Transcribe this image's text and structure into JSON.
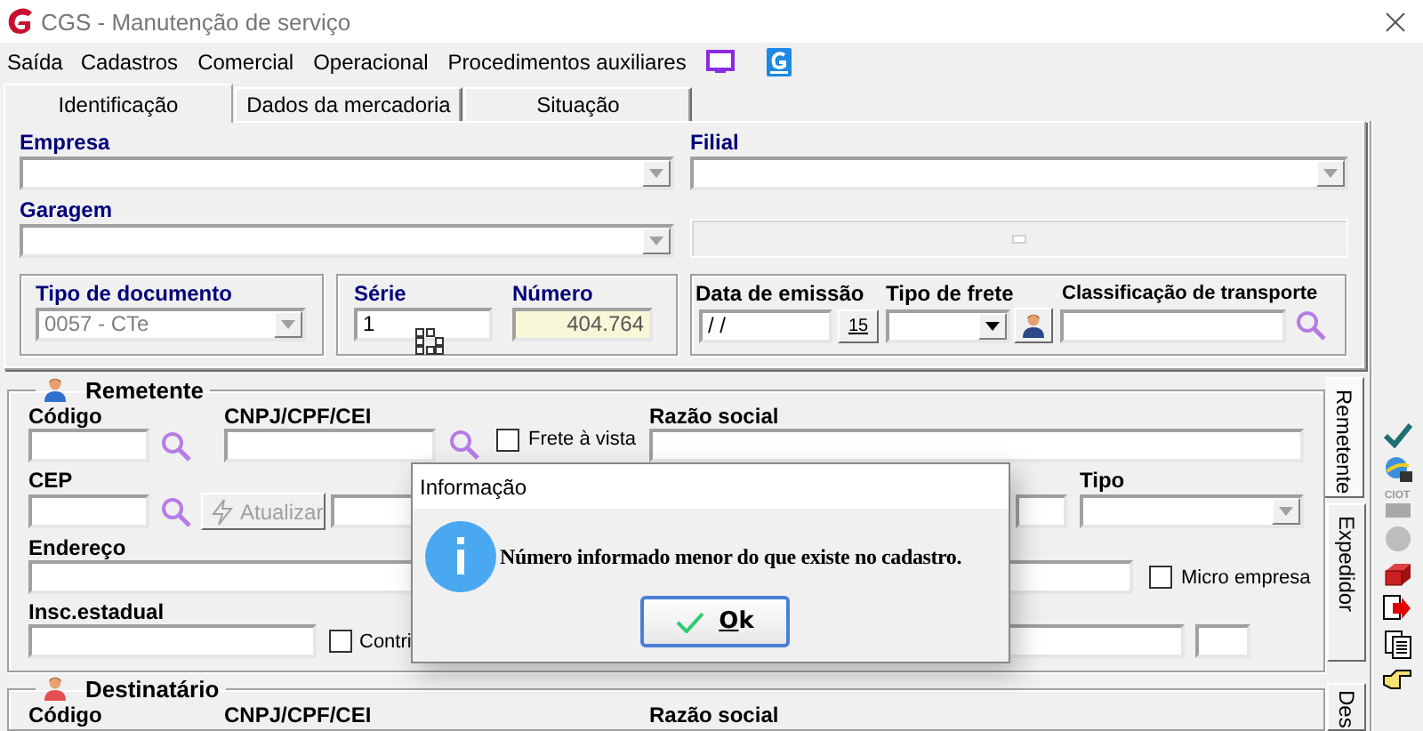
{
  "window": {
    "title": "CGS - Manutenção de serviço"
  },
  "menu": [
    "Saída",
    "Cadastros",
    "Comercial",
    "Operacional",
    "Procedimentos auxiliares"
  ],
  "tabs": [
    {
      "label": "Identificação",
      "selected": true
    },
    {
      "label": "Dados da mercadoria",
      "selected": false
    },
    {
      "label": "Situação",
      "selected": false
    }
  ],
  "identificacao": {
    "empresa": {
      "label": "Empresa"
    },
    "filial": {
      "label": "Filial"
    },
    "garagem": {
      "label": "Garagem"
    },
    "tipo_documento": {
      "label": "Tipo de documento",
      "value": "0057 - CTe",
      "disabled": true
    },
    "serie": {
      "label": "Série",
      "value": "1"
    },
    "numero": {
      "label": "Número",
      "value": "404.764"
    },
    "data_emissao": {
      "label": "Data de emissão",
      "value": "/ /"
    },
    "calendar": "15",
    "tipo_frete": {
      "label": "Tipo de frete"
    },
    "classificacao": {
      "label": "Classificação de transporte"
    }
  },
  "remetente": {
    "title": "Remetente",
    "codigo": "Código",
    "cnpj": "CNPJ/CPF/CEI",
    "frete_a_vista": {
      "label": "Frete à vista",
      "checked": false
    },
    "razao_social": "Razão social",
    "cep": "CEP",
    "atualizar": {
      "label": "Atualizar",
      "disabled": true
    },
    "tipo": "Tipo",
    "endereco": "Endereço",
    "micro_empresa": {
      "label": "Micro empresa",
      "checked": false
    },
    "insc_estadual": "Insc.estadual",
    "contribuinte": {
      "label": "Contri",
      "checked": false
    }
  },
  "destinatario": {
    "title": "Destinatário",
    "codigo": "Código",
    "cnpj": "CNPJ/CPF/CEI",
    "razao_social": "Razão social"
  },
  "side_tabs": [
    {
      "label": "Remetente",
      "selected": true
    },
    {
      "label": "Expedidor",
      "selected": false
    },
    {
      "label": "Des",
      "selected": false
    }
  ],
  "toolbar": {
    "ciot": "CIOT"
  },
  "dialog": {
    "title": "Informação",
    "message": "Número informado menor do que existe no cadastro.",
    "ok": "Ok"
  }
}
